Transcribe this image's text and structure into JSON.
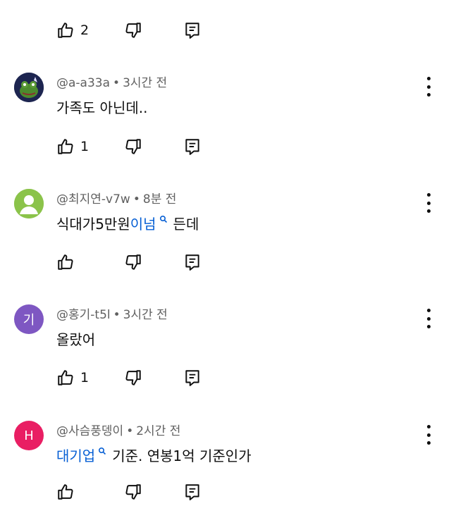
{
  "top_actions": {
    "like_count": "2"
  },
  "comments": [
    {
      "author": "@a-a33a",
      "time": "3시간 전",
      "text_parts": [
        "가족도 아닌데..",
        "",
        ""
      ],
      "like_count": "1",
      "avatar_letter": "",
      "avatar_color": "#1e2a5a"
    },
    {
      "author": "@최지연-v7w",
      "time": "8분 전",
      "text_parts": [
        "식대가5만원",
        "이넘",
        "든데"
      ],
      "like_count": "",
      "avatar_letter": "",
      "avatar_color": "#8bc34a"
    },
    {
      "author": "@홍기-t5l",
      "time": "3시간 전",
      "text_parts": [
        "올랐어",
        "",
        ""
      ],
      "like_count": "1",
      "avatar_letter": "기",
      "avatar_color": "#7e57c2"
    },
    {
      "author": "@사슴풍뎅이",
      "time": "2시간 전",
      "text_parts": [
        "",
        "대기업",
        "기준. 연봉1억 기준인가"
      ],
      "like_count": "",
      "avatar_letter": "H",
      "avatar_color": "#e91e63"
    }
  ],
  "separator": "•",
  "icons": [
    "thumb-up-icon",
    "thumb-down-icon",
    "reply-icon",
    "more-vert-icon",
    "search-icon"
  ]
}
